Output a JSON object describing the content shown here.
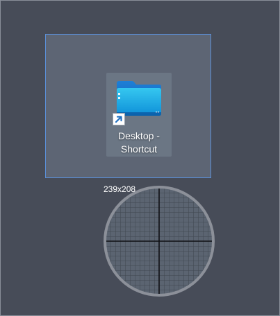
{
  "desktop": {
    "background_color": "#474c58"
  },
  "selection": {
    "border_color": "#5a8fd8"
  },
  "shortcut": {
    "label_line1": "Desktop -",
    "label_line2": "Shortcut",
    "icon": "folder-icon",
    "overlay_icon": "shortcut-arrow-icon"
  },
  "magnifier": {
    "size_readout": "239x208",
    "icon": "crosshair-icon"
  }
}
